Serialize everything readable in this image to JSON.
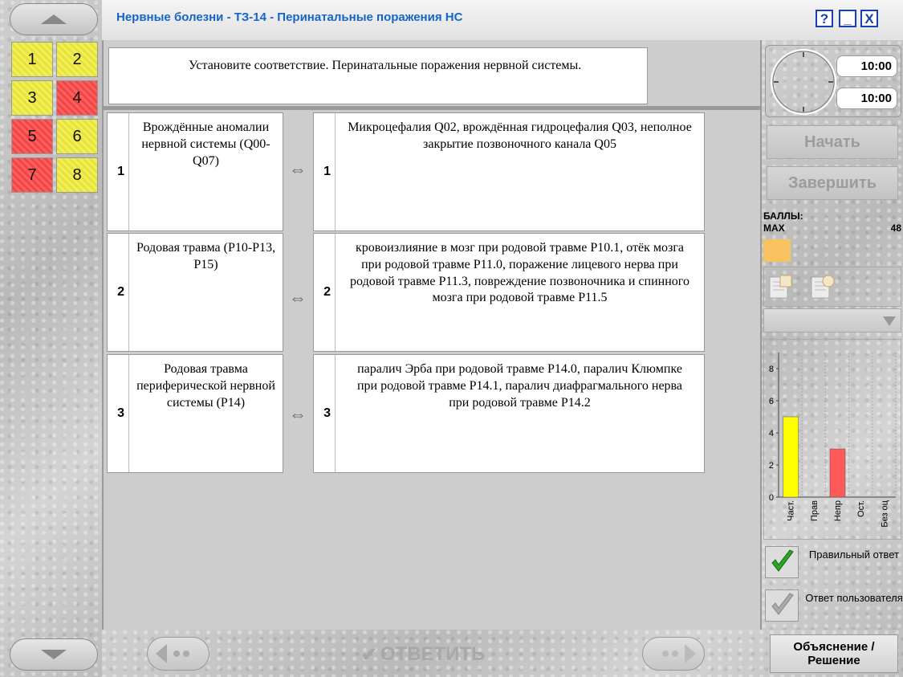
{
  "window": {
    "title": "Нервные болезни - ТЗ-14 - Перинатальные поражения НС",
    "help_label": "?",
    "minimize_label": "_",
    "close_label": "X"
  },
  "questions": [
    {
      "label": "1",
      "status": "yellow"
    },
    {
      "label": "2",
      "status": "yellow"
    },
    {
      "label": "3",
      "status": "yellow"
    },
    {
      "label": "4",
      "status": "red"
    },
    {
      "label": "5",
      "status": "red"
    },
    {
      "label": "6",
      "status": "yellow"
    },
    {
      "label": "7",
      "status": "red"
    },
    {
      "label": "8",
      "status": "yellow"
    }
  ],
  "task": {
    "prompt": "Установите соответствие. Перинатальные поражения нервной системы."
  },
  "pairs": [
    {
      "left_num": "1",
      "left": "Врождённые аномалии нервной системы (Q00-Q07)",
      "arrow": "⇔",
      "right_num": "1",
      "right": "Микроцефалия Q02, врождённая гидроцефалия Q03, неполное закрытие позвоночного канала Q05"
    },
    {
      "left_num": "2",
      "left": "Родовая травма (P10-P13, P15)",
      "arrow": "⇔",
      "right_num": "2",
      "right": "кровоизлияние в мозг при родовой травме P10.1, отёк мозга при родовой травме P11.0, поражение лицевого нерва при родовой травме P11.3, повреждение позвоночника и спинного мозга при родовой травме P11.5"
    },
    {
      "left_num": "3",
      "left": "Родовая травма периферической нервной системы (P14)",
      "arrow": "⇔",
      "right_num": "3",
      "right": "паралич Эрба при родовой травме P14.0, паралич Клюмпке при родовой травме P14.1, паралич диафрагмального нерва при родовой травме P14.2"
    }
  ],
  "timer": {
    "total": "10:00",
    "remaining": "10:00"
  },
  "controls": {
    "start_label": "Начать",
    "finish_label": "Завершить"
  },
  "score": {
    "title": "БАЛЛЫ:",
    "max_label": "MAX",
    "max_value": "48",
    "bar_color": "#f7c25f",
    "progress": 0.2
  },
  "chart_data": {
    "type": "bar",
    "categories": [
      "Част.",
      "Прав",
      "Непр",
      "Ост.",
      "Без оц"
    ],
    "values": [
      5,
      0,
      3,
      0,
      0
    ],
    "colors": [
      "#ffff00",
      "#7cdd4c",
      "#ff5a5a",
      "#cccccc",
      "#cccccc"
    ],
    "yticks": [
      "0",
      "2",
      "4",
      "6",
      "8"
    ],
    "ylim": [
      0,
      9
    ],
    "grid": true
  },
  "legend": {
    "correct_label": "Правильный ответ",
    "user_label": "Ответ пользователя"
  },
  "bottom": {
    "answer_label": "ОТВЕТИТЬ",
    "explain_label": "Объяснение / Решение"
  }
}
